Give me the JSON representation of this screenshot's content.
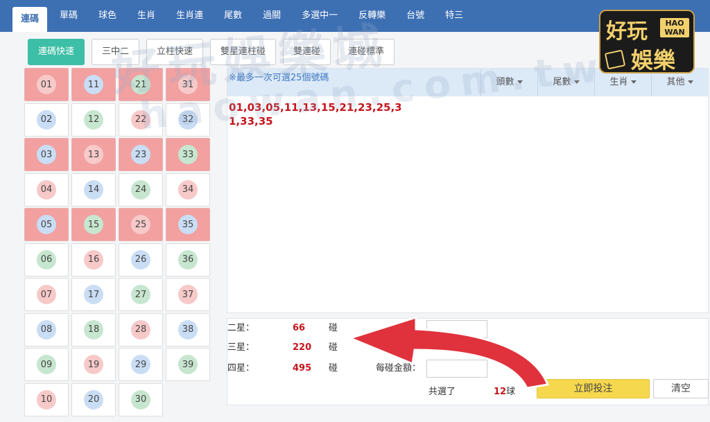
{
  "nav": {
    "tabs": [
      "連碼",
      "單碼",
      "球色",
      "生肖",
      "生肖連",
      "尾數",
      "過關",
      "多選中一",
      "反轉樂",
      "台號",
      "特三"
    ],
    "active_index": 0
  },
  "logo": {
    "line1": "好玩",
    "line2": "娛樂",
    "en": "HAO WAN"
  },
  "watermark": {
    "line1": "好玩娛樂城",
    "line2": "haowan.com.tw"
  },
  "subbar": {
    "buttons": [
      "連碼快速",
      "三中二",
      "立柱快速",
      "雙星連柱碰",
      "雙連碰",
      "連碰標準"
    ],
    "active_index": 0
  },
  "grid": {
    "selected": [
      "01",
      "03",
      "05",
      "11",
      "13",
      "15",
      "21",
      "23",
      "25",
      "31",
      "33",
      "35"
    ],
    "columns": [
      [
        {
          "n": "01",
          "c": "red"
        },
        {
          "n": "02",
          "c": "blue"
        },
        {
          "n": "03",
          "c": "blue"
        },
        {
          "n": "04",
          "c": "red"
        },
        {
          "n": "05",
          "c": "blue"
        },
        {
          "n": "06",
          "c": "green"
        },
        {
          "n": "07",
          "c": "red"
        },
        {
          "n": "08",
          "c": "blue"
        },
        {
          "n": "09",
          "c": "green"
        },
        {
          "n": "10",
          "c": "red"
        }
      ],
      [
        {
          "n": "11",
          "c": "blue"
        },
        {
          "n": "12",
          "c": "green"
        },
        {
          "n": "13",
          "c": "red"
        },
        {
          "n": "14",
          "c": "blue"
        },
        {
          "n": "15",
          "c": "green"
        },
        {
          "n": "16",
          "c": "red"
        },
        {
          "n": "17",
          "c": "blue"
        },
        {
          "n": "18",
          "c": "green"
        },
        {
          "n": "19",
          "c": "red"
        },
        {
          "n": "20",
          "c": "blue"
        }
      ],
      [
        {
          "n": "21",
          "c": "green"
        },
        {
          "n": "22",
          "c": "red"
        },
        {
          "n": "23",
          "c": "blue"
        },
        {
          "n": "24",
          "c": "green"
        },
        {
          "n": "25",
          "c": "red"
        },
        {
          "n": "26",
          "c": "blue"
        },
        {
          "n": "27",
          "c": "green"
        },
        {
          "n": "28",
          "c": "red"
        },
        {
          "n": "29",
          "c": "blue"
        },
        {
          "n": "30",
          "c": "green"
        }
      ],
      [
        {
          "n": "31",
          "c": "red"
        },
        {
          "n": "32",
          "c": "blue"
        },
        {
          "n": "33",
          "c": "green"
        },
        {
          "n": "34",
          "c": "red"
        },
        {
          "n": "35",
          "c": "blue"
        },
        {
          "n": "36",
          "c": "green"
        },
        {
          "n": "37",
          "c": "red"
        },
        {
          "n": "38",
          "c": "blue"
        },
        {
          "n": "39",
          "c": "green"
        }
      ]
    ]
  },
  "panel": {
    "notice": "※最多一次可選25個號碼",
    "dropdowns": [
      "頭數",
      "尾數",
      "生肖",
      "其他"
    ],
    "selected_text": "01,03,05,11,13,15,21,23,25,31,33,35"
  },
  "bottom": {
    "rows": [
      {
        "label": "二星：",
        "value": "66",
        "unit": "碰"
      },
      {
        "label": "三星：",
        "value": "220",
        "unit": "碰"
      },
      {
        "label": "四星：",
        "value": "495",
        "unit": "碰"
      }
    ],
    "amount_label": "每碰金額：",
    "total_label": "共選了",
    "total_count": "12",
    "total_unit": "球",
    "bet_button": "立即投注",
    "clear_button": "清空"
  },
  "colors": {
    "nav": "#3d6fb3",
    "accent": "#3dbea6",
    "selected_cell": "#f2a0a0",
    "number_red": "#c4161c",
    "bet": "#f5d84e",
    "arrow": "#e0323c"
  }
}
